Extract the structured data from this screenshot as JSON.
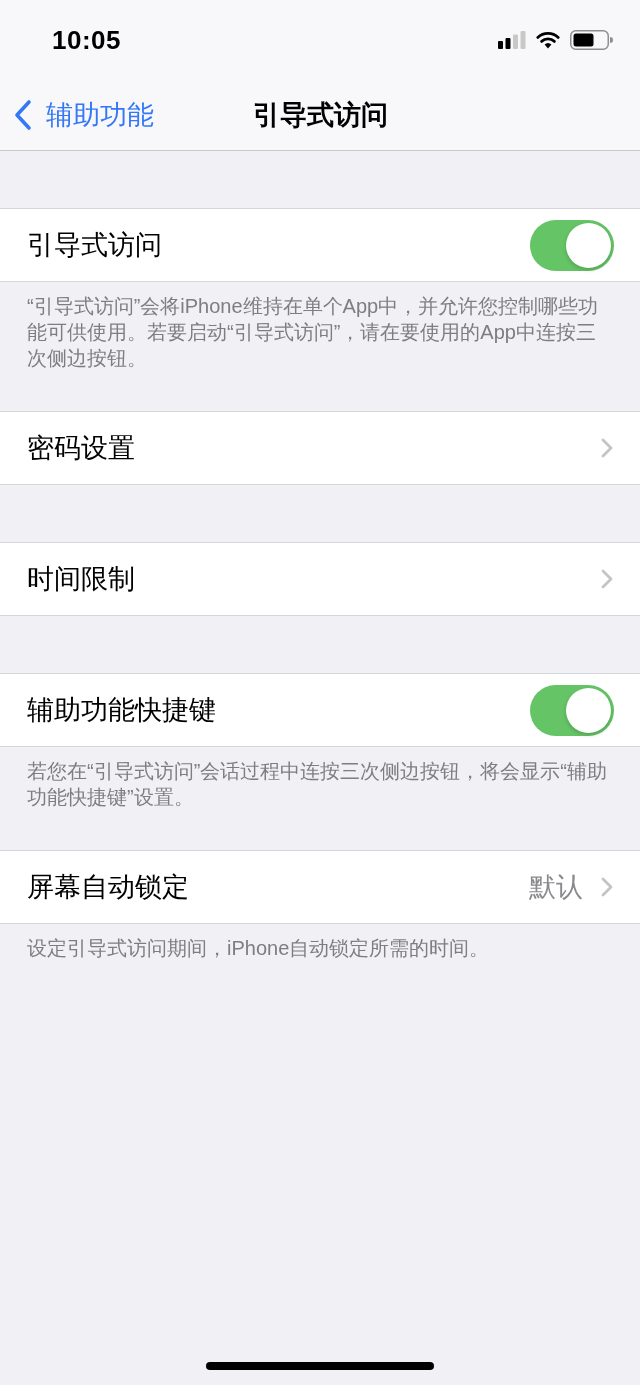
{
  "status_bar": {
    "time": "10:05"
  },
  "nav": {
    "back": "辅助功能",
    "title": "引导式访问"
  },
  "sections": [
    {
      "rows": [
        {
          "kind": "toggle",
          "label": "引导式访问",
          "on": true
        }
      ],
      "footer": "“引导式访问”会将iPhone维持在单个App中，并允许您控制哪些功能可供使用。若要启动“引导式访问”，请在要使用的App中连按三次侧边按钮。"
    },
    {
      "rows": [
        {
          "kind": "link",
          "label": "密码设置"
        }
      ]
    },
    {
      "rows": [
        {
          "kind": "link",
          "label": "时间限制"
        }
      ]
    },
    {
      "rows": [
        {
          "kind": "toggle",
          "label": "辅助功能快捷键",
          "on": true
        }
      ],
      "footer": "若您在“引导式访问”会话过程中连按三次侧边按钮，将会显示“辅助功能快捷键”设置。"
    },
    {
      "rows": [
        {
          "kind": "link",
          "label": "屏幕自动锁定",
          "value": "默认"
        }
      ],
      "footer": "设定引导式访问期间，iPhone自动锁定所需的时间。"
    }
  ]
}
